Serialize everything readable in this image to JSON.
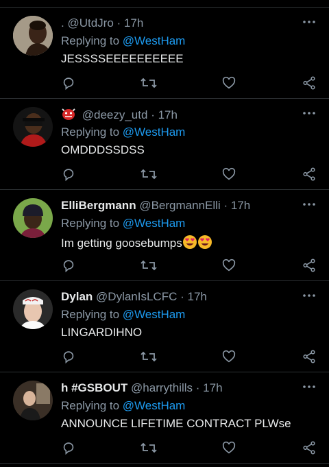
{
  "tweets": [
    {
      "name": "",
      "handle": ". @UtdJro",
      "dot": "·",
      "time": "17h",
      "replying_prefix": "Replying to ",
      "replying_handle": "@WestHam",
      "text": "JESSSSEEEEEEEEEE",
      "emojis": [],
      "avatar_icon": "man-dark-portrait-avatar"
    },
    {
      "name": "",
      "handle": "@deezy_utd",
      "dot": "·",
      "time": "17h",
      "name_emoji": "ogre-mask-emoji",
      "replying_prefix": "Replying to ",
      "replying_handle": "@WestHam",
      "text": "OMDDDSSDSS",
      "emojis": [],
      "avatar_icon": "masked-hero-avatar"
    },
    {
      "name": "ElliBergmann",
      "handle": "@BergmannElli",
      "dot": "·",
      "time": "17h",
      "replying_prefix": "Replying to ",
      "replying_handle": "@WestHam",
      "text": "Im getting goosebumps",
      "emojis": [
        "heart-eyes-emoji",
        "heart-eyes-emoji"
      ],
      "avatar_icon": "beanie-player-avatar"
    },
    {
      "name": "Dylan",
      "handle": "@DylanIsLCFC",
      "dot": "·",
      "time": "17h",
      "replying_prefix": "Replying to ",
      "replying_handle": "@WestHam",
      "text": "LINGARDIHNO",
      "emojis": [],
      "avatar_icon": "gucci-player-avatar"
    },
    {
      "name": "h #GSBOUT",
      "handle": "@harrythills",
      "dot": "·",
      "time": "17h",
      "replying_prefix": "Replying to ",
      "replying_handle": "@WestHam",
      "text": "ANNOUNCE LIFETIME CONTRACT PLWse",
      "emojis": [],
      "avatar_icon": "dark-room-avatar"
    }
  ],
  "actions": [
    "reply-icon",
    "retweet-icon",
    "like-icon",
    "share-icon"
  ],
  "more_icon": "more-options-icon",
  "colors": {
    "background": "#000000",
    "divider": "#2f3336",
    "secondary_text": "#8b98a5",
    "link": "#1d9bf0",
    "primary_text": "#e7e9ea"
  }
}
